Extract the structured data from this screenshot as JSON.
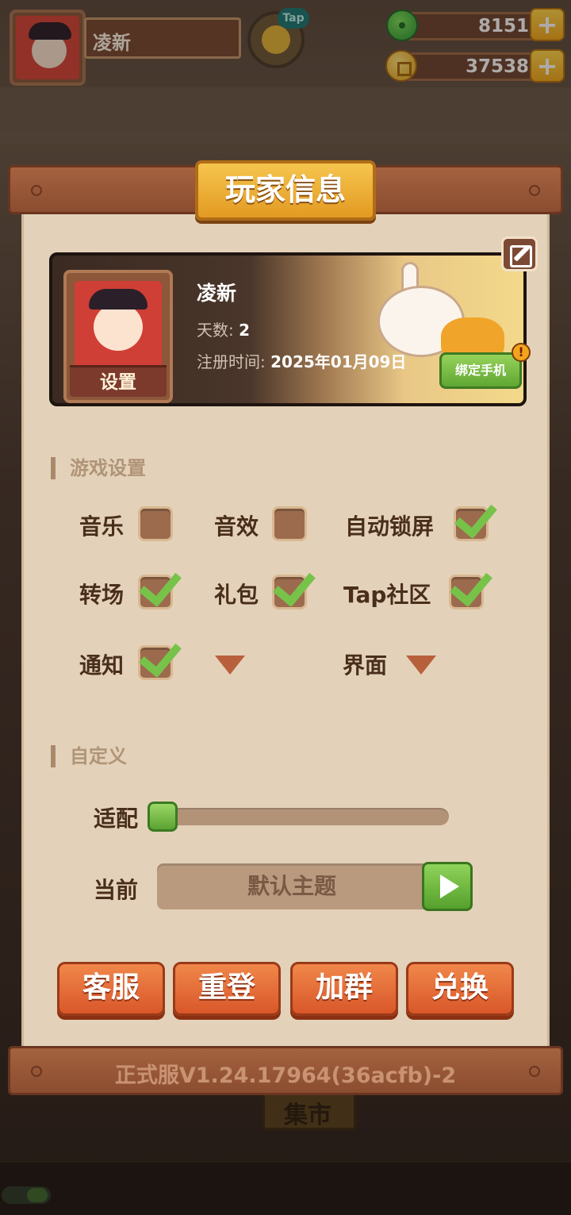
{
  "hud": {
    "player_name": "凌新",
    "tap_badge": "Tap",
    "jade_amount": "8151",
    "coin_amount": "37538",
    "plus": "+"
  },
  "dialog": {
    "title": "玩家信息",
    "profile": {
      "name": "凌新",
      "days_label": "天数: ",
      "days_value": "2",
      "register_label": "注册时间: ",
      "register_value": "2025年01月09日",
      "settings_label": "设置",
      "bind_phone": "绑定手机",
      "alert": "!"
    },
    "game_settings": {
      "header": "游戏设置",
      "options": [
        {
          "label": "音乐",
          "checked": false
        },
        {
          "label": "音效",
          "checked": false
        },
        {
          "label": "自动锁屏",
          "checked": true
        },
        {
          "label": "转场",
          "checked": true
        },
        {
          "label": "礼包",
          "checked": true
        },
        {
          "label": "Tap社区",
          "checked": true
        },
        {
          "label": "通知",
          "checked": true
        }
      ],
      "interface_label": "界面"
    },
    "custom": {
      "header": "自定义",
      "fit_label": "适配",
      "fit_value": 0.0,
      "current_label": "当前",
      "theme_value": "默认主题"
    },
    "buttons": [
      "客服",
      "重登",
      "加群",
      "兑换"
    ],
    "version": "正式服V1.24.17964(36acfb)-2"
  },
  "background": {
    "market_sign": "集市"
  },
  "colors": {
    "accent_orange": "#d9572a",
    "check_green": "#77c34a",
    "panel_bg": "#e3d2b9",
    "title_gold": "#f2a91c"
  }
}
